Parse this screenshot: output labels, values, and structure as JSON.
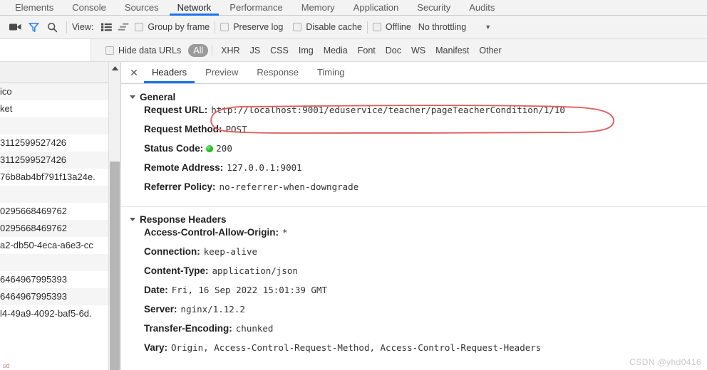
{
  "devtools": {
    "panel_tabs": [
      {
        "label": "Elements",
        "active": false
      },
      {
        "label": "Console",
        "active": false
      },
      {
        "label": "Sources",
        "active": false
      },
      {
        "label": "Network",
        "active": true
      },
      {
        "label": "Performance",
        "active": false
      },
      {
        "label": "Memory",
        "active": false
      },
      {
        "label": "Application",
        "active": false
      },
      {
        "label": "Security",
        "active": false
      },
      {
        "label": "Audits",
        "active": false
      }
    ]
  },
  "toolbar": {
    "record_icon": "record-camera-icon",
    "clear_icon": "filter-funnel-icon",
    "search_icon": "search-magnifier-icon",
    "view_label": "View:",
    "view_list_icon": "list-view-icon",
    "view_waterfall_icon": "waterfall-view-icon",
    "group_by_frame": "Group by frame",
    "preserve_log": "Preserve log",
    "disable_cache": "Disable cache",
    "offline": "Offline",
    "throttling": "No throttling",
    "throttling_caret": "▼"
  },
  "filter_row": {
    "filter_placeholder": "",
    "filter_value": "",
    "hide_data_urls": "Hide data URLs",
    "types": [
      {
        "label": "All",
        "active": true
      },
      {
        "label": "XHR",
        "active": false
      },
      {
        "label": "JS",
        "active": false
      },
      {
        "label": "CSS",
        "active": false
      },
      {
        "label": "Img",
        "active": false
      },
      {
        "label": "Media",
        "active": false
      },
      {
        "label": "Font",
        "active": false
      },
      {
        "label": "Doc",
        "active": false
      },
      {
        "label": "WS",
        "active": false
      },
      {
        "label": "Manifest",
        "active": false
      },
      {
        "label": "Other",
        "active": false
      }
    ]
  },
  "request_list": {
    "rows": [
      {
        "text": "",
        "style": "head"
      },
      {
        "text": "ico",
        "style": "alt"
      },
      {
        "text": "ket",
        "style": "plain"
      },
      {
        "text": "",
        "style": "alt"
      },
      {
        "text": "3112599527426",
        "style": "plain"
      },
      {
        "text": "3112599527426",
        "style": "alt"
      },
      {
        "text": "76b8ab4bf791f13a24e.",
        "style": "plain"
      },
      {
        "text": "",
        "style": "alt"
      },
      {
        "text": "0295668469762",
        "style": "plain"
      },
      {
        "text": "0295668469762",
        "style": "alt"
      },
      {
        "text": "a2-db50-4eca-a6e3-cc",
        "style": "plain"
      },
      {
        "text": "",
        "style": "alt"
      },
      {
        "text": "6464967995393",
        "style": "plain"
      },
      {
        "text": "6464967995393",
        "style": "alt"
      },
      {
        "text": "l4-49a9-4092-baf5-6d.",
        "style": "plain"
      }
    ],
    "ghost_text": "sd"
  },
  "detail": {
    "close_icon": "close-x-icon",
    "tabs": [
      {
        "label": "Headers",
        "active": true
      },
      {
        "label": "Preview",
        "active": false
      },
      {
        "label": "Response",
        "active": false
      },
      {
        "label": "Timing",
        "active": false
      }
    ],
    "general": {
      "title": "General",
      "rows": [
        {
          "key": "Request URL:",
          "value": "http://localhost:9001/eduservice/teacher/pageTeacherCondition/1/10",
          "highlighted": true
        },
        {
          "key": "Request Method:",
          "value": "POST"
        },
        {
          "key": "Status Code:",
          "value": "200",
          "status_dot": true
        },
        {
          "key": "Remote Address:",
          "value": "127.0.0.1:9001"
        },
        {
          "key": "Referrer Policy:",
          "value": "no-referrer-when-downgrade"
        }
      ]
    },
    "response_headers": {
      "title": "Response Headers",
      "rows": [
        {
          "key": "Access-Control-Allow-Origin:",
          "value": "*"
        },
        {
          "key": "Connection:",
          "value": "keep-alive"
        },
        {
          "key": "Content-Type:",
          "value": "application/json"
        },
        {
          "key": "Date:",
          "value": "Fri, 16 Sep 2022 15:01:39 GMT"
        },
        {
          "key": "Server:",
          "value": "nginx/1.12.2"
        },
        {
          "key": "Transfer-Encoding:",
          "value": "chunked"
        },
        {
          "key": "Vary:",
          "value": "Origin, Access-Control-Request-Method, Access-Control-Request-Headers"
        }
      ]
    }
  },
  "annotation": {
    "shape": "red-ellipse-highlight",
    "color": "#e05b5b"
  },
  "watermark": {
    "text": "CSDN @yhd0416"
  },
  "colors": {
    "accent": "#1a73e8",
    "toolbar_bg": "#f3f3f3",
    "status_green": "#25c425",
    "annotation_red": "#e05b5b"
  }
}
